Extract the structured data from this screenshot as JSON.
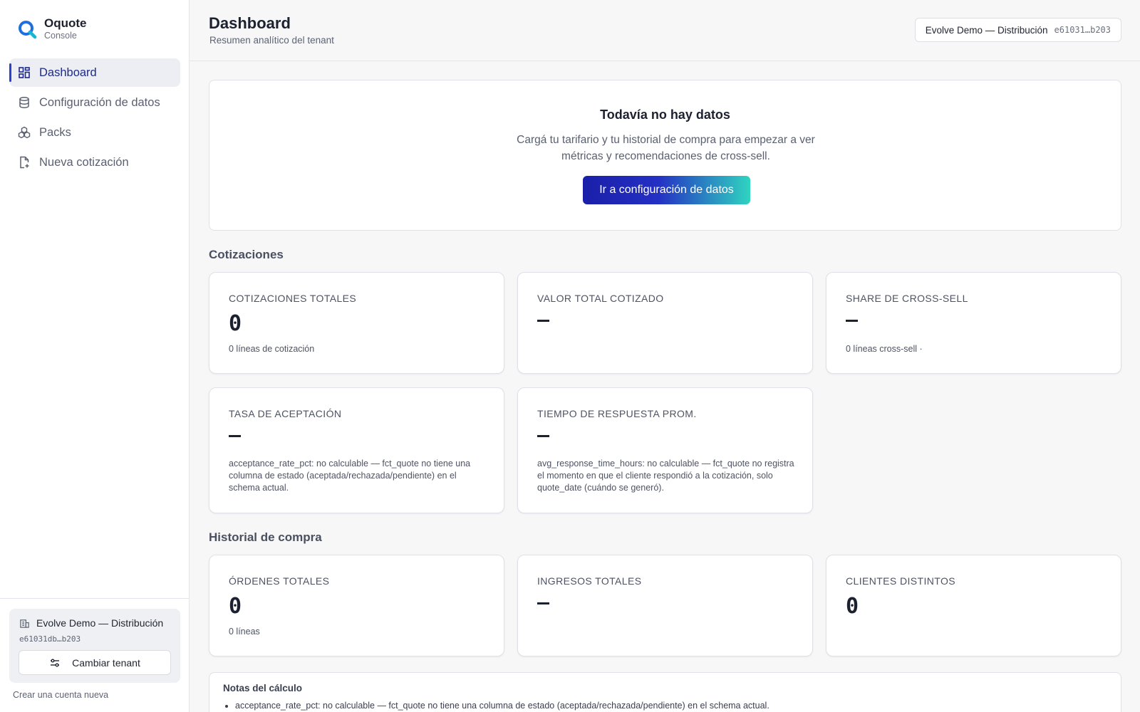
{
  "brand": {
    "name": "Oquote",
    "subtitle": "Console",
    "logo_color": "#1f6fe0"
  },
  "sidebar": {
    "items": [
      {
        "label": "Dashboard",
        "icon": "grid-icon",
        "active": true
      },
      {
        "label": "Configuración de datos",
        "icon": "database-icon",
        "active": false
      },
      {
        "label": "Packs",
        "icon": "packs-icon",
        "active": false
      },
      {
        "label": "Nueva cotización",
        "icon": "new-document-icon",
        "active": false
      }
    ],
    "tenant": {
      "name": "Evolve Demo — Distribución",
      "id": "e61031db…b203",
      "switch_label": "Cambiar tenant",
      "icon": "building-icon"
    },
    "new_account_link": "Crear una cuenta nueva"
  },
  "header": {
    "title": "Dashboard",
    "subtitle": "Resumen analítico del tenant",
    "tenant_name": "Evolve Demo — Distribución",
    "tenant_id": "e61031…b203"
  },
  "empty_state": {
    "title": "Todavía no hay datos",
    "description": "Cargá tu tarifario y tu historial de compra para empezar a ver métricas y recomendaciones de cross-sell.",
    "cta_label": "Ir a configuración de datos"
  },
  "sections": {
    "quotes": {
      "title": "Cotizaciones",
      "cards": [
        {
          "label": "COTIZACIONES TOTALES",
          "value": "0",
          "note": "0 líneas de cotización"
        },
        {
          "label": "VALOR TOTAL COTIZADO",
          "value": "–",
          "note": ""
        },
        {
          "label": "SHARE DE CROSS-SELL",
          "value": "–",
          "note": "0 líneas cross-sell ·"
        },
        {
          "label": "TASA DE ACEPTACIÓN",
          "value": "–",
          "note": "acceptance_rate_pct: no calculable — fct_quote no tiene una columna de estado (aceptada/rechazada/pendiente) en el schema actual."
        },
        {
          "label": "TIEMPO DE RESPUESTA PROM.",
          "value": "–",
          "note": "avg_response_time_hours: no calculable — fct_quote no registra el momento en que el cliente respondió a la cotización, solo quote_date (cuándo se generó)."
        }
      ]
    },
    "purchases": {
      "title": "Historial de compra",
      "cards": [
        {
          "label": "ÓRDENES TOTALES",
          "value": "0",
          "note": "0 líneas"
        },
        {
          "label": "INGRESOS TOTALES",
          "value": "–",
          "note": ""
        },
        {
          "label": "CLIENTES DISTINTOS",
          "value": "0",
          "note": ""
        }
      ]
    }
  },
  "notes": {
    "title": "Notas del cálculo",
    "items": [
      "acceptance_rate_pct: no calculable — fct_quote no tiene una columna de estado (aceptada/rechazada/pendiente) en el schema actual."
    ]
  },
  "colors": {
    "accent": "#2b3fd1",
    "cta_start": "#1a1fa8",
    "cta_end": "#2fd4c0"
  }
}
